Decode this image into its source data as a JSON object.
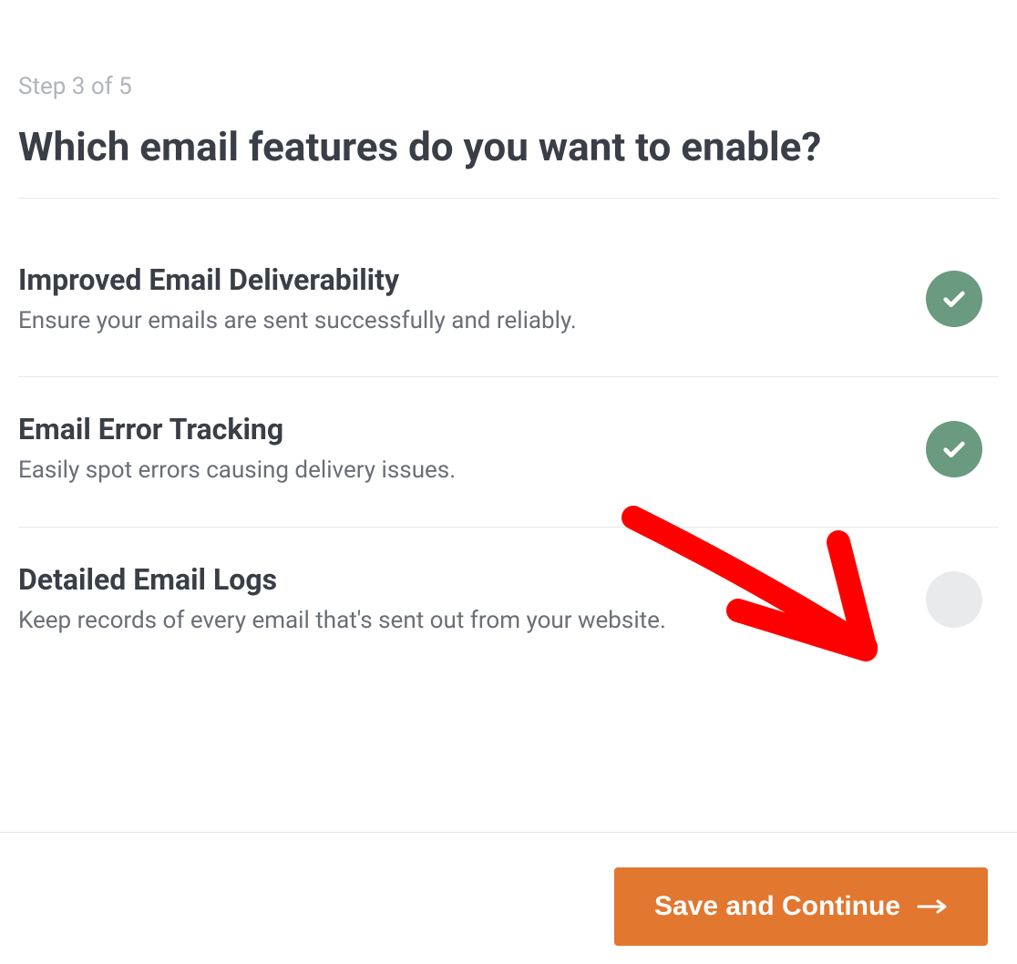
{
  "step": {
    "label": "Step 3 of 5"
  },
  "title": "Which email features do you want to enable?",
  "features": [
    {
      "title": "Improved Email Deliverability",
      "description": "Ensure your emails are sent successfully and reliably.",
      "enabled": true
    },
    {
      "title": "Email Error Tracking",
      "description": "Easily spot errors causing delivery issues.",
      "enabled": true
    },
    {
      "title": "Detailed Email Logs",
      "description": "Keep records of every email that's sent out from your website.",
      "enabled": false
    }
  ],
  "footer": {
    "save_label": "Save and Continue"
  },
  "colors": {
    "accent": "#e27730",
    "toggle_on": "#6a9a7f",
    "toggle_off": "#e9eaec",
    "annotation": "#ff0000"
  }
}
